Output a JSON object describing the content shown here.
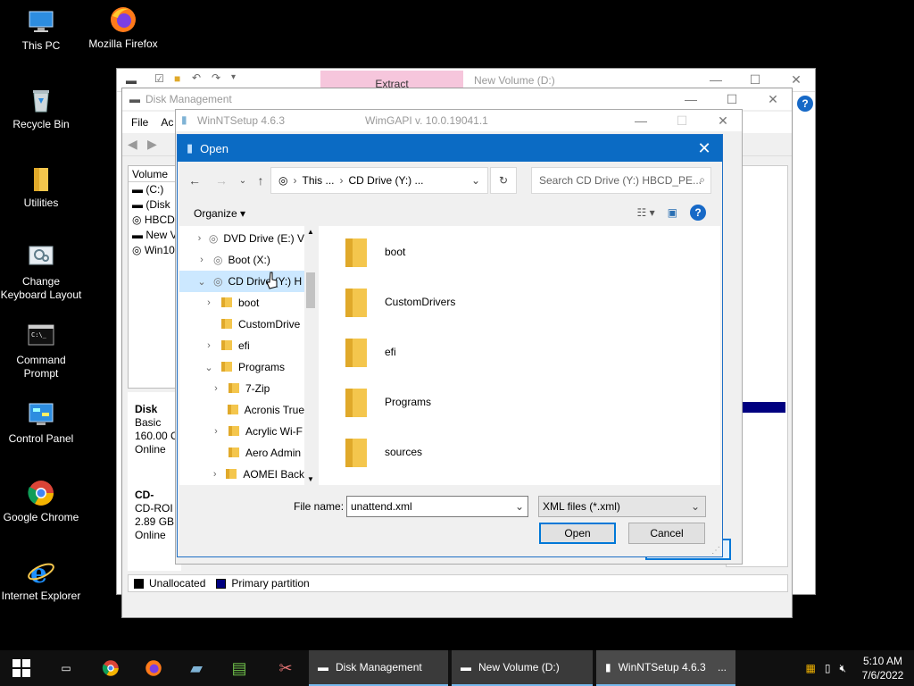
{
  "desktop": {
    "icons": [
      {
        "label": "This PC"
      },
      {
        "label": "Mozilla Firefox"
      },
      {
        "label": "Recycle Bin"
      },
      {
        "label": "Utilities"
      },
      {
        "label": "Change Keyboard Layout"
      },
      {
        "label": "Command Prompt"
      },
      {
        "label": "Control Panel"
      },
      {
        "label": "Google Chrome"
      },
      {
        "label": "Internet Explorer"
      }
    ]
  },
  "win_newvol": {
    "extract_label": "Extract",
    "title": "New Volume (D:)"
  },
  "win_disk": {
    "title": "Disk Management",
    "menu": [
      "File",
      "Ac"
    ],
    "volume_header": "Volume",
    "volumes": [
      "(C:)",
      "(Disk",
      "HBCD",
      "New V",
      "Win10"
    ],
    "disk0": {
      "name": "Disk",
      "type": "Basic",
      "size": "160.00 C",
      "status": "Online"
    },
    "disk1": {
      "name": "CD-",
      "type": "CD-ROI",
      "size": "2.89 GB",
      "status": "Online"
    },
    "legend": {
      "unallocated": "Unallocated",
      "primary": "Primary partition"
    }
  },
  "win_ntsetup": {
    "title": "WinNTSetup 4.6.3",
    "wimgapi": "WimGAPI v. 10.0.19041.1"
  },
  "open_dialog": {
    "title": "Open",
    "address": {
      "part1": "This ...",
      "part2": "CD Drive (Y:) ..."
    },
    "search_placeholder": "Search CD Drive (Y:) HBCD_PE...",
    "organize": "Organize",
    "tree": [
      {
        "label": "DVD Drive (E:) V",
        "level": 0,
        "expander": ">"
      },
      {
        "label": "Boot (X:)",
        "level": 0,
        "expander": ">"
      },
      {
        "label": "CD Drive (Y:) H",
        "level": 0,
        "expander": "v",
        "selected": true
      },
      {
        "label": "boot",
        "level": 1,
        "expander": ">"
      },
      {
        "label": "CustomDrive",
        "level": 1,
        "expander": ""
      },
      {
        "label": "efi",
        "level": 1,
        "expander": ">"
      },
      {
        "label": "Programs",
        "level": 1,
        "expander": "v"
      },
      {
        "label": "7-Zip",
        "level": 2,
        "expander": ">"
      },
      {
        "label": "Acronis True",
        "level": 2,
        "expander": ""
      },
      {
        "label": "Acrylic Wi-F",
        "level": 2,
        "expander": ">"
      },
      {
        "label": "Aero Admin",
        "level": 2,
        "expander": ""
      },
      {
        "label": "AOMEI Back",
        "level": 2,
        "expander": ">"
      }
    ],
    "files": [
      "boot",
      "CustomDrivers",
      "efi",
      "Programs",
      "sources"
    ],
    "file_name_label": "File name:",
    "file_name_value": "unattend.xml",
    "file_type": "XML files (*.xml)",
    "open_button": "Open",
    "cancel_button": "Cancel"
  },
  "taskbar": {
    "apps": [
      {
        "label": "Disk Management"
      },
      {
        "label": "New Volume (D:)"
      },
      {
        "label": "WinNTSetup 4.6.3    ..."
      }
    ],
    "time": "5:10 AM",
    "date": "7/6/2022"
  },
  "colors": {
    "dialog_title": "#0b6bc4",
    "folder": "#f4c64d",
    "selection": "#cce8ff",
    "accent": "#0078d7"
  }
}
